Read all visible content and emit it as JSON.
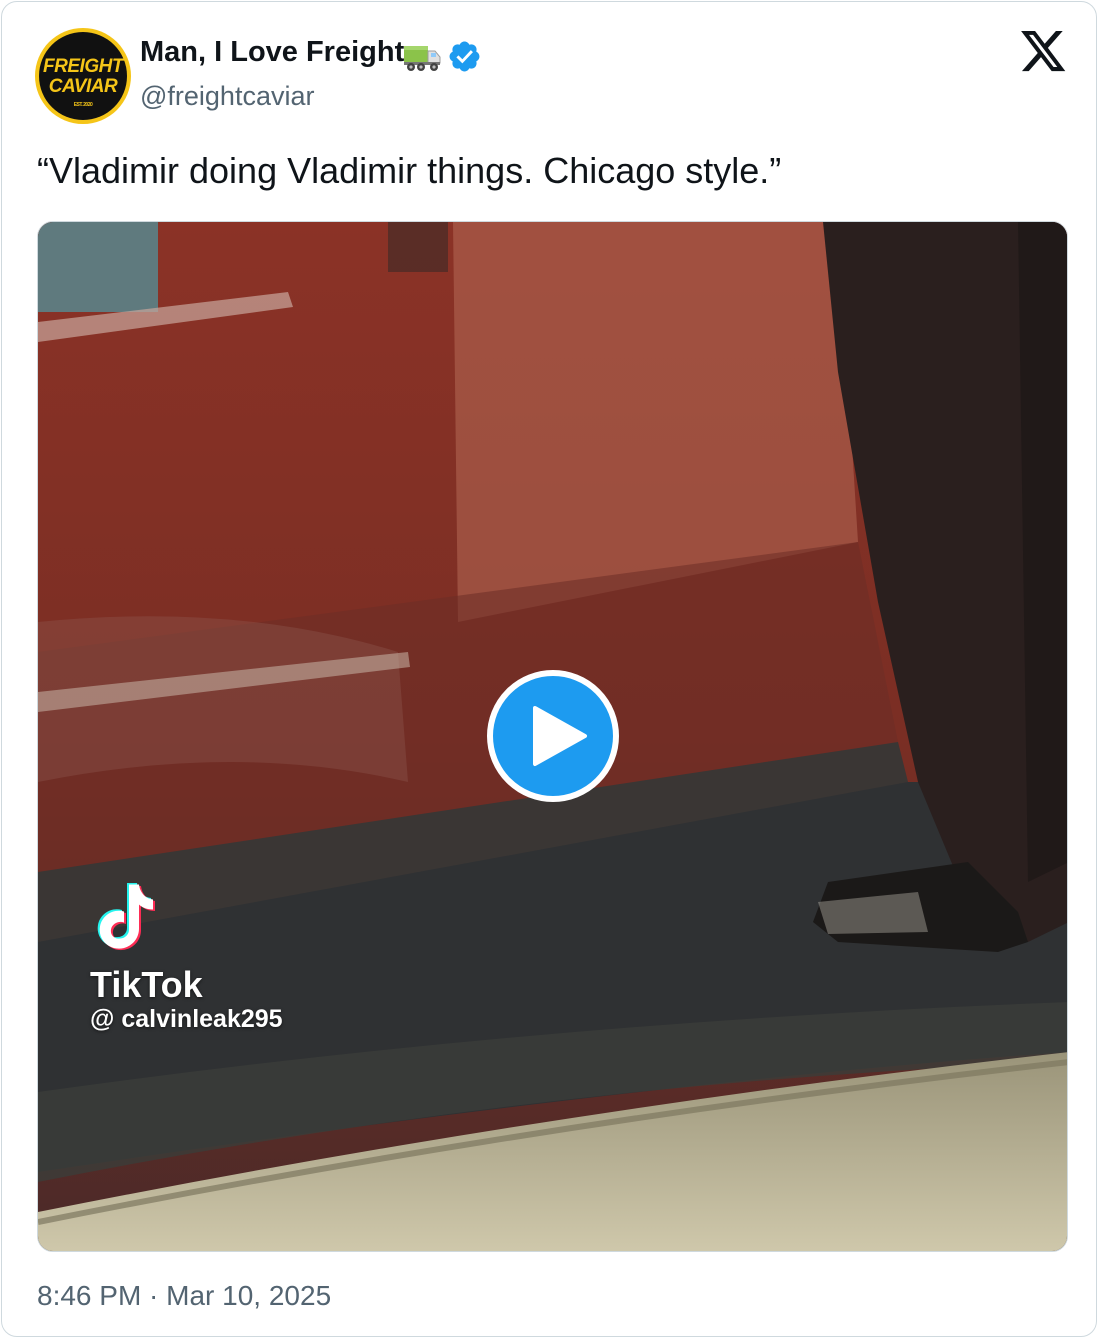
{
  "tweet": {
    "author": {
      "display_name": "Man, I Love Freight",
      "handle": "@freightcaviar",
      "avatar_logo_line1": "FREIGHT",
      "avatar_logo_line2": "CAVIAR",
      "avatar_logo_line3": "EST. 2020",
      "name_emoji": "truck-icon",
      "verified": true
    },
    "text": "“Vladimir doing Vladimir things. Chicago style.”",
    "media": {
      "type": "video",
      "watermark_brand": "TikTok",
      "watermark_user": "@ calvinleak295"
    },
    "timestamp": "8:46 PM · Mar 10, 2025"
  },
  "colors": {
    "verified": "#1d9bf0",
    "play_button": "#1d9bf0",
    "text_primary": "#0f1419",
    "text_secondary": "#536471",
    "avatar_yellow": "#f5c518"
  }
}
